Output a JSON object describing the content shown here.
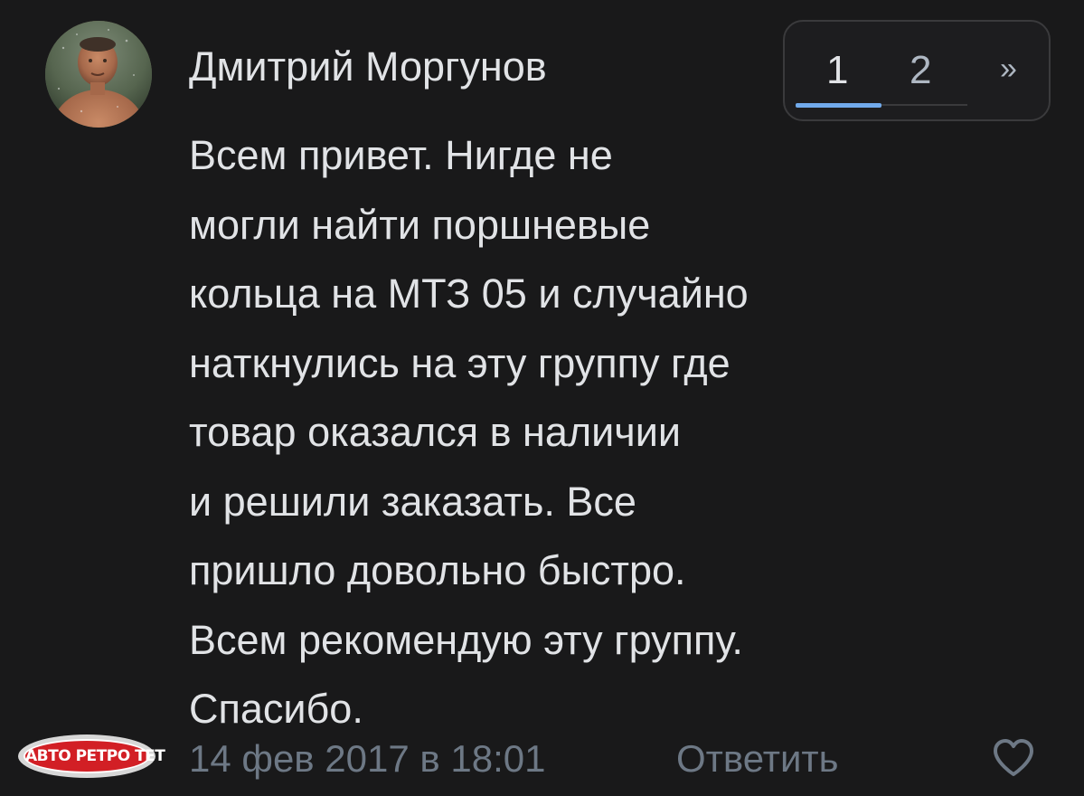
{
  "comment": {
    "author": "Дмитрий Моргунов",
    "text_lines": [
      "Всем привет. Нигде не",
      "могли найти поршневые",
      "кольца на МТЗ 05 и случайно",
      "наткнулись на эту группу где",
      "товар оказался в наличии",
      "и решили заказать. Все",
      "пришло довольно быстро.",
      "Всем рекомендую эту группу.",
      "Спасибо."
    ],
    "date": "14 фев 2017 в 18:01",
    "reply_label": "Ответить",
    "like_icon": "heart-outline-icon"
  },
  "pagination": {
    "pages": [
      "1",
      "2"
    ],
    "active_page": "1",
    "next_label": "»"
  },
  "badge": {
    "text": "АВТО РЕТРО ТЕТ"
  },
  "colors": {
    "background": "#19191a",
    "text_primary": "#e1e3e6",
    "text_secondary": "#6d7885",
    "accent": "#71aaeb",
    "badge_red": "#d21f25"
  }
}
